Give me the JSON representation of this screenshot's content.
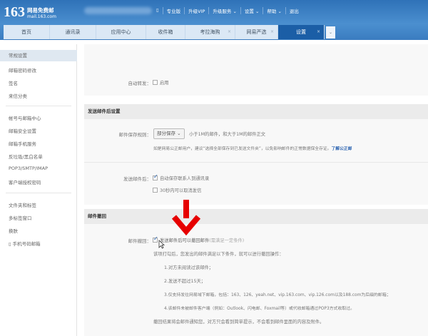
{
  "header": {
    "logo_number": "163",
    "logo_title": "网易免费邮",
    "logo_domain": "mail.163.com",
    "nav": [
      "专业版",
      "升级VIP",
      "升级服务 ⌄",
      "设置 ⌄",
      "帮助 ⌄",
      "退出"
    ]
  },
  "tabs": [
    {
      "label": "首页",
      "close": ""
    },
    {
      "label": "通讯录",
      "close": ""
    },
    {
      "label": "应用中心",
      "close": ""
    },
    {
      "label": "收件箱",
      "close": ""
    },
    {
      "label": "考拉海购",
      "close": "×"
    },
    {
      "label": "网易严选",
      "close": "×"
    },
    {
      "label": "设置",
      "close": "×"
    }
  ],
  "tab_dropdown": "⌄",
  "sidebar": {
    "items": [
      "常规设置",
      "邮箱密码修改",
      "签名",
      "来信分类",
      "帐号与邮箱中心",
      "邮箱安全设置",
      "邮箱手机服务",
      "反垃圾/黑白名单",
      "POP3/SMTP/IMAP",
      "客户端授权密码",
      "文件夹和标签",
      "多标签窗口",
      "换肤",
      "手机号码邮箱"
    ]
  },
  "auto_forward": {
    "label": "自动转发：",
    "option": "启用"
  },
  "after_send": {
    "title": "发送邮件后设置",
    "save_rule_label": "邮件保存规则：",
    "save_rule_value": "部分保存 ⌄",
    "save_rule_desc": "小于1M的邮件，和大于1M的邮件正文",
    "note": "如是网易公正邮用户，建议“选择全部保存到已发送文件夹”，以免影响邮件的正常数据保全存证。",
    "note_link": "了解公正邮",
    "after_label": "发送邮件后：",
    "opt1": "自动保存联系人到通讯录",
    "opt2": "30秒内可以取消发信"
  },
  "recall": {
    "title": "邮件撤回",
    "label": "邮件撤回：",
    "option": "发送邮件后可以撤回邮件",
    "option_hint": "(需满足一定条件)",
    "intro": "该项打勾后，您发出的邮件满足以下条件，就可以进行撤回操作：",
    "conditions": [
      "1.对方未阅读过该邮件；",
      "2.发送不超过15天；",
      "3.仅支持发往网易域下邮箱，包括：163、126、yeah.net、vip.163.com、vip.126.com以及188.com为后缀的邮箱；",
      "4.该邮件未被邮件客户端（例如：Outlook、闪电邮、Foxmail等）或代收邮箱通过POP3方式收取过。"
    ],
    "footer": "撤回结果将会邮件通知您，对方只会看到简单提示，不会看到邮件里面的内容及附件。"
  },
  "colors": {
    "header": "#3a7cc0",
    "active_tab": "#1b5ea6",
    "arrow": "#e60000"
  }
}
